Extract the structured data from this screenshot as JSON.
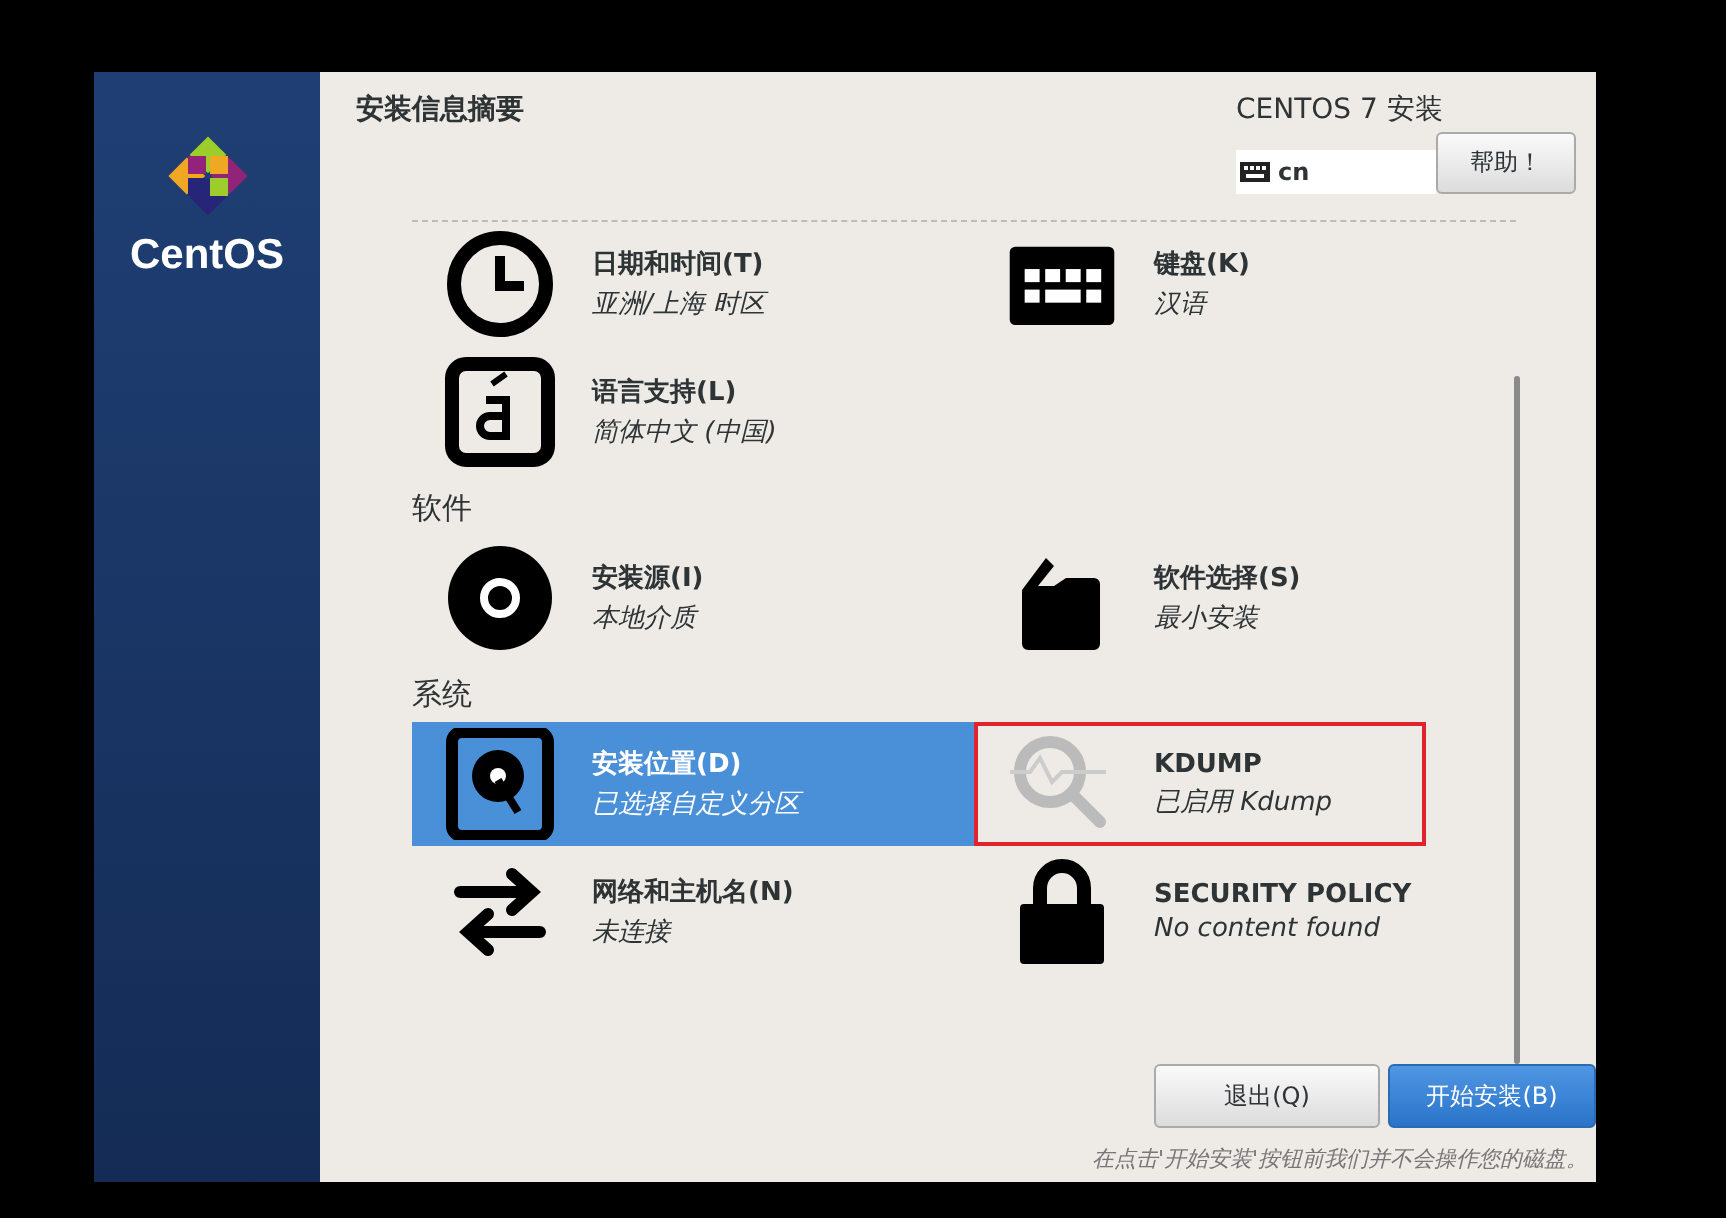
{
  "sidebar": {
    "logo_text": "CentOS"
  },
  "header": {
    "title": "安装信息摘要",
    "product": "CENTOS 7 安装",
    "keyboard_layout": "cn",
    "help_button": "帮助！"
  },
  "sections": [
    {
      "items": [
        {
          "kind": "clock",
          "title": "日期和时间(T)",
          "status": "亚洲/上海 时区",
          "selected": false,
          "highlighted": false
        },
        {
          "kind": "keyboard",
          "title": "键盘(K)",
          "status": "汉语",
          "selected": false,
          "highlighted": false
        },
        {
          "kind": "language",
          "title": "语言支持(L)",
          "status": "简体中文 (中国)",
          "selected": false,
          "highlighted": false
        }
      ]
    },
    {
      "heading": "软件",
      "items": [
        {
          "kind": "disc",
          "title": "安装源(I)",
          "status": "本地介质",
          "selected": false,
          "highlighted": false
        },
        {
          "kind": "package",
          "title": "软件选择(S)",
          "status": "最小安装",
          "selected": false,
          "highlighted": false
        }
      ]
    },
    {
      "heading": "系统",
      "items": [
        {
          "kind": "disk",
          "title": "安装位置(D)",
          "status": "已选择自定义分区",
          "selected": true,
          "highlighted": false
        },
        {
          "kind": "search",
          "title": "KDUMP",
          "status": "已启用 Kdump",
          "selected": false,
          "highlighted": true
        },
        {
          "kind": "network",
          "title": "网络和主机名(N)",
          "status": "未连接",
          "selected": false,
          "highlighted": false
        },
        {
          "kind": "lock",
          "title": "SECURITY POLICY",
          "status": "No content found",
          "selected": false,
          "highlighted": false
        }
      ]
    }
  ],
  "footer": {
    "buttons": [
      {
        "label": "退出(Q)",
        "kind": "secondary"
      },
      {
        "label": "开始安装(B)",
        "kind": "primary"
      }
    ],
    "note": "在点击'开始安装'按钮前我们并不会操作您的磁盘。"
  }
}
